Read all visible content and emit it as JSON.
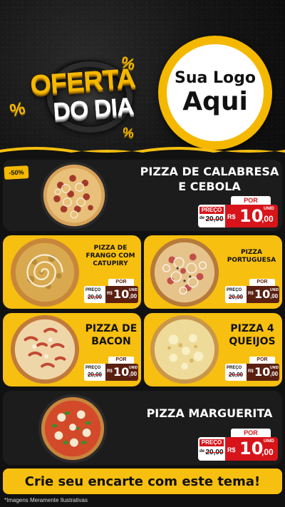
{
  "header": {
    "headline_line1": "OFERTA",
    "headline_line2": "DO DIA",
    "percent_symbol": "%",
    "logo_line1": "Sua Logo",
    "logo_line2": "Aqui"
  },
  "colors": {
    "brand_yellow": "#f7bf0f",
    "price_red": "#d7141a",
    "price_brown": "#5a1f10",
    "card_dark": "#1c1c1c",
    "background": "#111111"
  },
  "discount_badge": "-50%",
  "products": [
    {
      "name_line1": "PIZZA DE CALABRESA",
      "name_line2": "E CEBOLA",
      "por_label": "POR",
      "preco_label": "PREÇO",
      "de_label": "de",
      "old_price": "20,00",
      "currency": "R$",
      "price_int": "10",
      "price_cents": ",00",
      "unit": "UNID"
    },
    {
      "name_line1": "PIZZA DE",
      "name_line2": "FRANGO COM",
      "name_line3": "CATUPIRY",
      "por_label": "POR",
      "preco_label": "PREÇO",
      "old_price": "20,00",
      "currency": "R$",
      "price_int": "10",
      "price_cents": ",00",
      "unit": "UNID"
    },
    {
      "name_line1": "PIZZA",
      "name_line2": "PORTUGUESA",
      "por_label": "POR",
      "preco_label": "PREÇO",
      "old_price": "20,00",
      "currency": "R$",
      "price_int": "10",
      "price_cents": ",00",
      "unit": "UNID"
    },
    {
      "name_line1": "PIZZA DE",
      "name_line2": "BACON",
      "por_label": "POR",
      "preco_label": "PREÇO",
      "old_price": "20,00",
      "currency": "R$",
      "price_int": "10",
      "price_cents": ",00",
      "unit": "UNID"
    },
    {
      "name_line1": "PIZZA 4",
      "name_line2": "QUEIJOS",
      "por_label": "POR",
      "preco_label": "PREÇO",
      "old_price": "20,00",
      "currency": "R$",
      "price_int": "10",
      "price_cents": ",00",
      "unit": "UNID"
    },
    {
      "name_line1": "PIZZA MARGUERITA",
      "por_label": "POR",
      "preco_label": "PREÇO",
      "de_label": "de",
      "old_price": "20,00",
      "currency": "R$",
      "price_int": "10",
      "price_cents": ",00",
      "unit": "UNID"
    }
  ],
  "footer": {
    "cta": "Crie seu encarte com este tema!",
    "disclaimer": "*Imagens Meramente Ilustrativas"
  }
}
